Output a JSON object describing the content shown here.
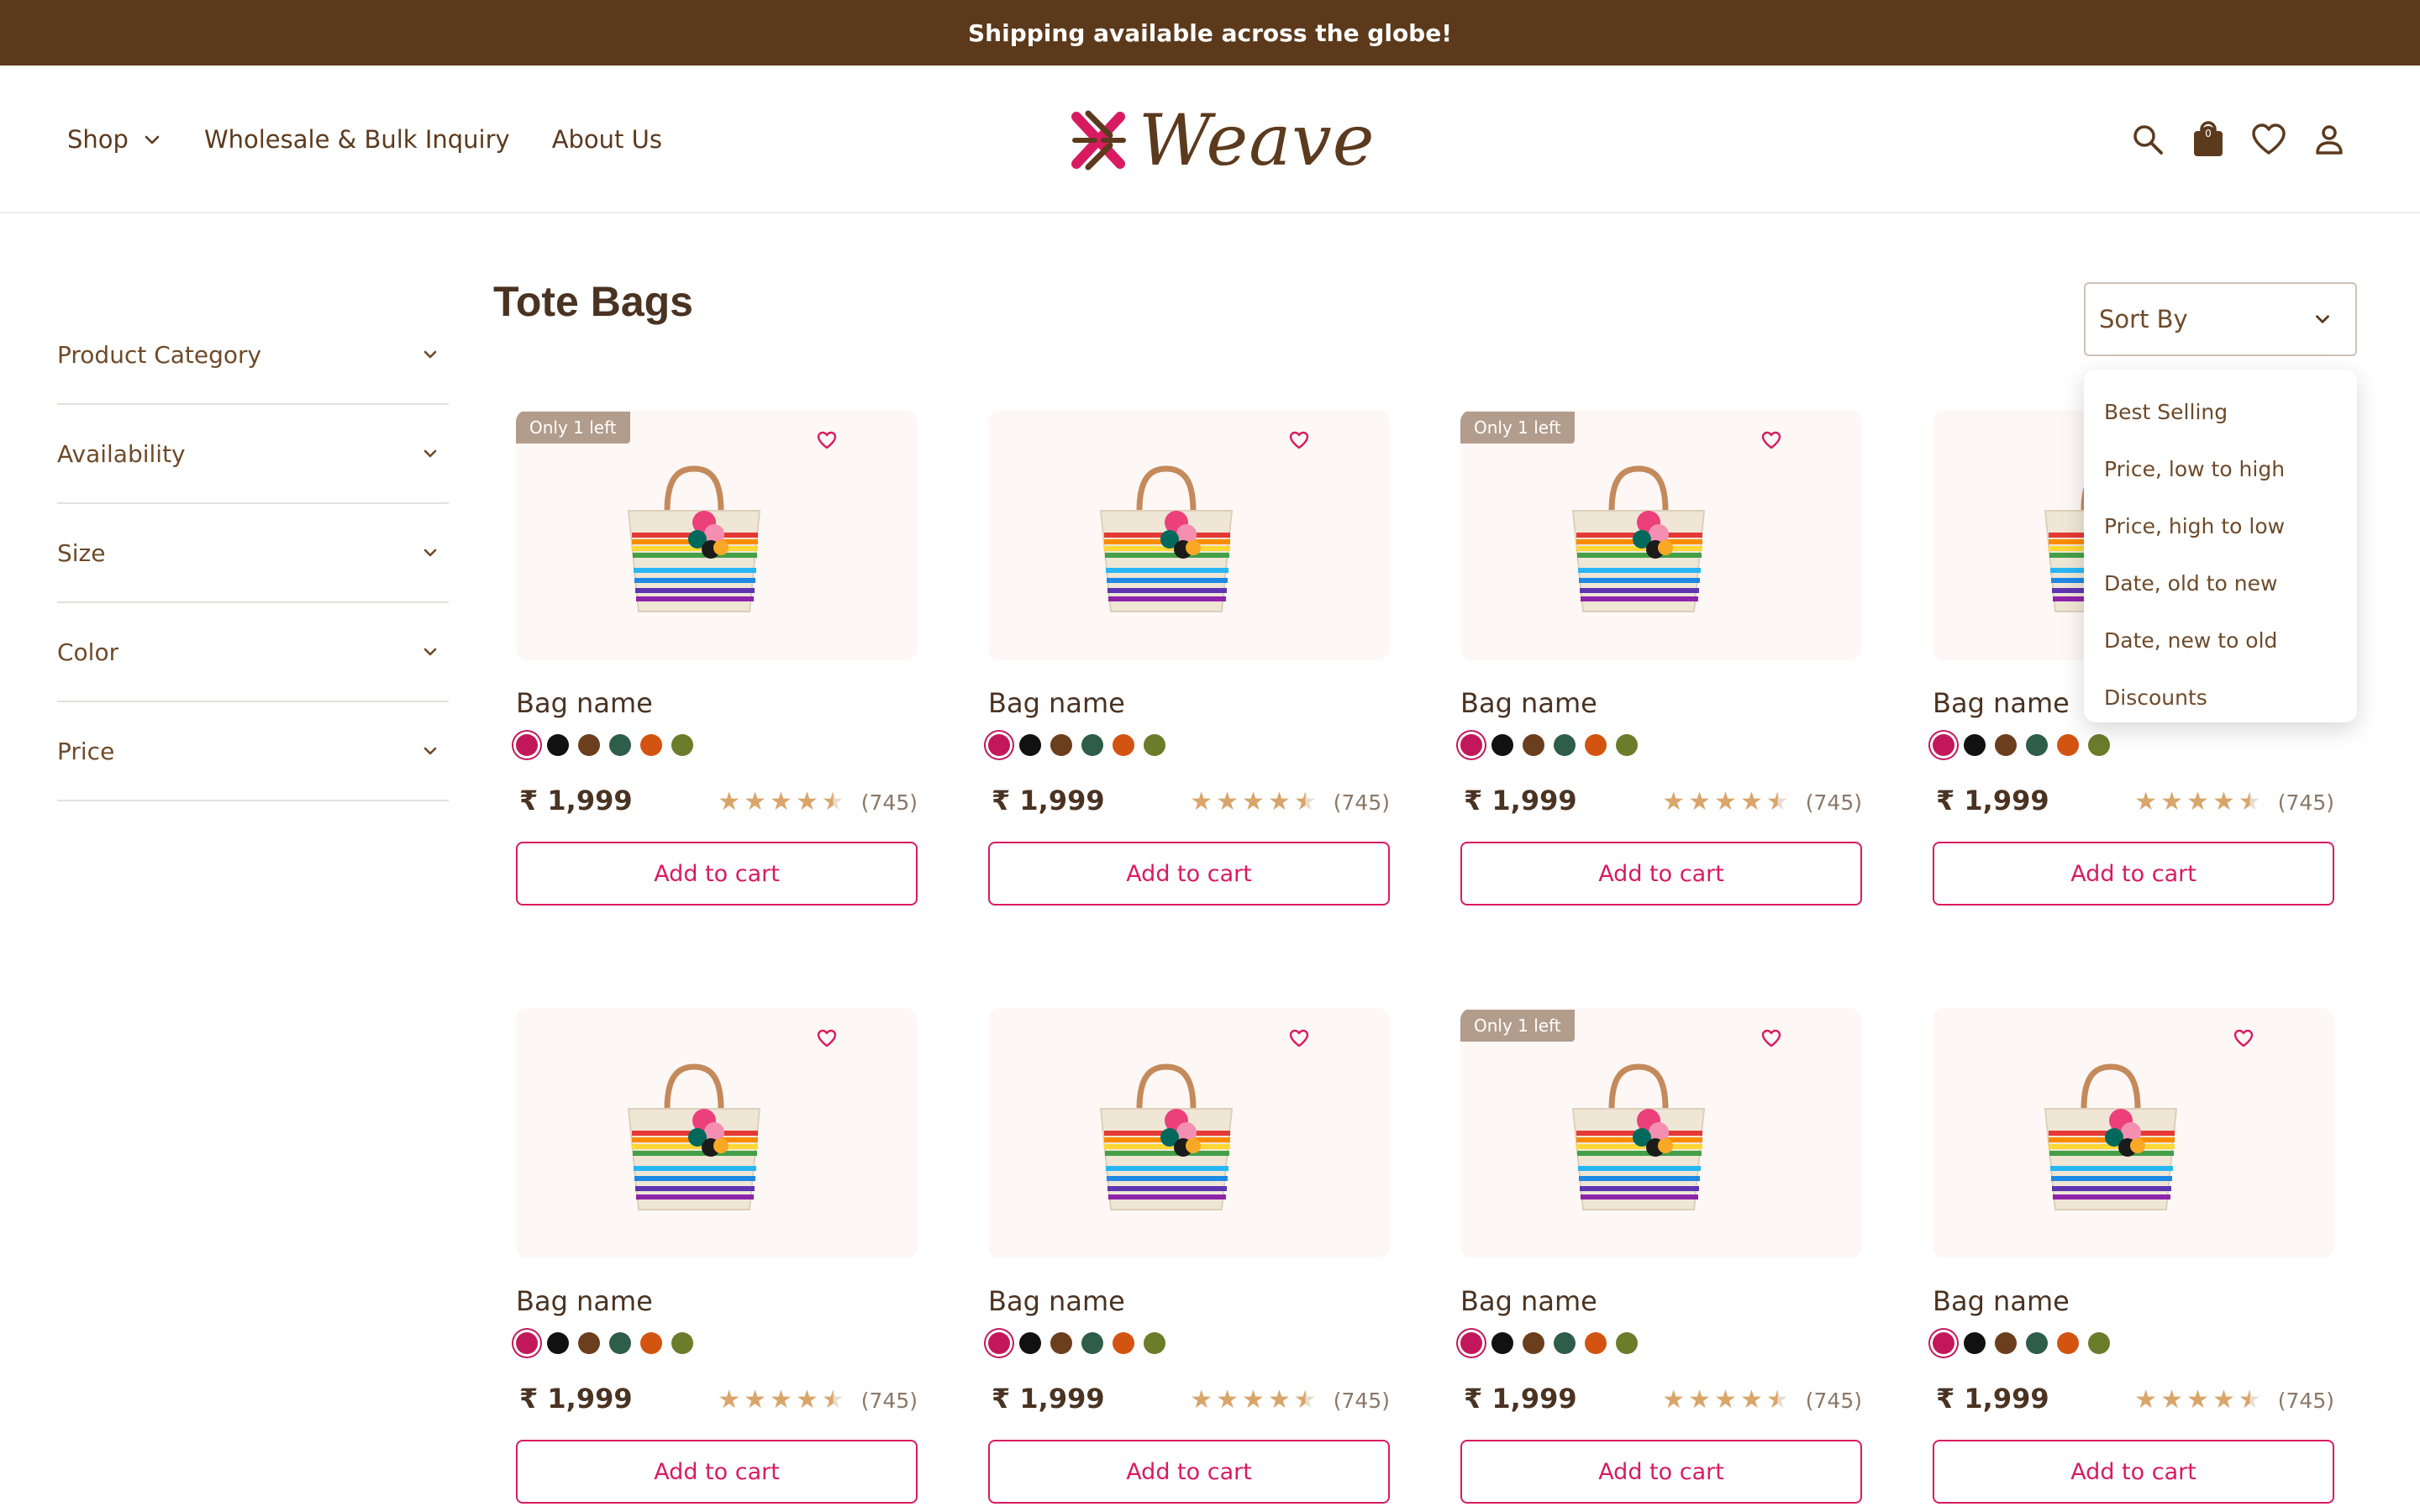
{
  "announcement": "Shipping available across the globe!",
  "nav": {
    "shop": "Shop",
    "wholesale": "Wholesale & Bulk Inquiry",
    "about": "About Us"
  },
  "brand": {
    "name": "Weave"
  },
  "header_icons": {
    "cart_count": "0"
  },
  "filters": [
    {
      "label": "Product Category"
    },
    {
      "label": "Availability"
    },
    {
      "label": "Size"
    },
    {
      "label": "Color"
    },
    {
      "label": "Price"
    }
  ],
  "page_title": "Tote Bags",
  "sort": {
    "label": "Sort By",
    "options": [
      "Best Selling",
      "Price, low to high",
      "Price, high to low",
      "Date, old to new",
      "Date, new to old",
      "Discounts"
    ]
  },
  "swatch_colors": [
    "#c2185b",
    "#111111",
    "#6b3e1e",
    "#2f5d4b",
    "#d35411",
    "#6b7c2b"
  ],
  "products": [
    {
      "name": "Bag name",
      "badge": "Only 1 left",
      "price": "₹ 1,999",
      "rating": 4.5,
      "reviews": "(745)",
      "cta": "Add to cart"
    },
    {
      "name": "Bag name",
      "badge": "",
      "price": "₹ 1,999",
      "rating": 4.5,
      "reviews": "(745)",
      "cta": "Add to cart"
    },
    {
      "name": "Bag name",
      "badge": "Only 1 left",
      "price": "₹ 1,999",
      "rating": 4.5,
      "reviews": "(745)",
      "cta": "Add to cart"
    },
    {
      "name": "Bag name",
      "badge": "",
      "price": "₹ 1,999",
      "rating": 4.5,
      "reviews": "(745)",
      "cta": "Add to cart"
    },
    {
      "name": "Bag name",
      "badge": "",
      "price": "₹ 1,999",
      "rating": 4.5,
      "reviews": "(745)",
      "cta": "Add to cart"
    },
    {
      "name": "Bag name",
      "badge": "",
      "price": "₹ 1,999",
      "rating": 4.5,
      "reviews": "(745)",
      "cta": "Add to cart"
    },
    {
      "name": "Bag name",
      "badge": "Only 1 left",
      "price": "₹ 1,999",
      "rating": 4.5,
      "reviews": "(745)",
      "cta": "Add to cart"
    },
    {
      "name": "Bag name",
      "badge": "",
      "price": "₹ 1,999",
      "rating": 4.5,
      "reviews": "(745)",
      "cta": "Add to cart"
    }
  ]
}
